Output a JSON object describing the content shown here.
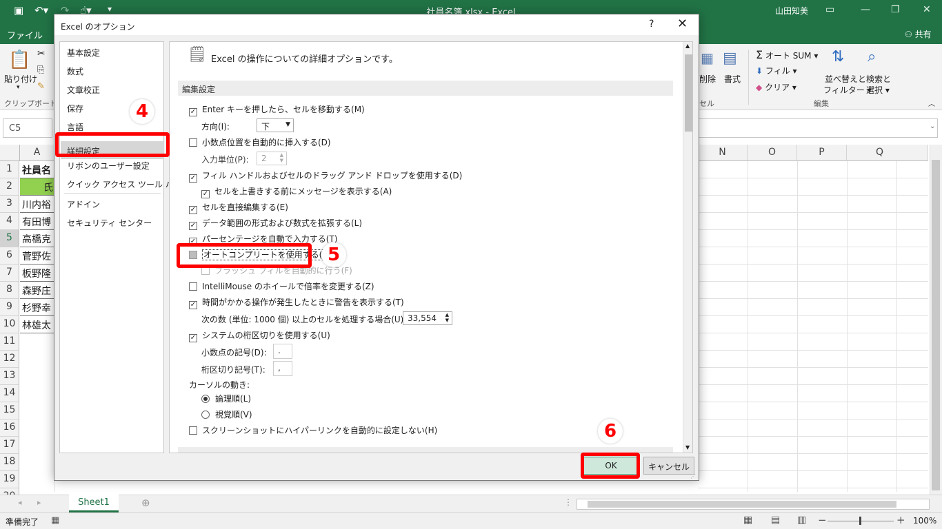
{
  "window": {
    "title": "社員名簿.xlsx  -  Excel",
    "user": "山田知美"
  },
  "ribbon": {
    "file_tab": "ファイル",
    "share": "共有",
    "paste_label": "貼り付け",
    "clipboard_group": "クリップボード",
    "delete_label": "削除",
    "format_label": "書式",
    "cells_group": "セル",
    "autosum": "オート SUM",
    "fill": "フィル",
    "clear": "クリア",
    "sort_filter_1": "並べ替えと",
    "sort_filter_2": "フィルター",
    "find_select_1": "検索と",
    "find_select_2": "選択",
    "edit_group": "編集"
  },
  "formula_bar": {
    "name_box": "C5"
  },
  "grid": {
    "col_headers_right": [
      "N",
      "O",
      "P",
      "Q"
    ],
    "row_numbers": [
      "1",
      "2",
      "3",
      "4",
      "5",
      "6",
      "7",
      "8",
      "9",
      "10",
      "11",
      "12",
      "13",
      "14",
      "15",
      "16",
      "17",
      "18",
      "19",
      "20"
    ],
    "a1": "社員名",
    "a2": "氏",
    "names": [
      "川内裕",
      "有田博",
      "高橋克",
      "菅野佐",
      "板野隆",
      "森野庄",
      "杉野幸",
      "林雄太"
    ]
  },
  "sheet_tabs": {
    "sheet1": "Sheet1"
  },
  "status_bar": {
    "ready": "準備完了",
    "zoom": "100%"
  },
  "dialog": {
    "title": "Excel のオプション",
    "help": "?",
    "close": "✕",
    "nav": [
      "基本設定",
      "数式",
      "文章校正",
      "保存",
      "言語",
      "詳細設定",
      "リボンのユーザー設定",
      "クイック アクセス ツール バー",
      "アドイン",
      "セキュリティ センター"
    ],
    "header": "Excel の操作についての詳細オプションです。",
    "section_edit": "編集設定",
    "options": {
      "enter_move": "Enter キーを押したら、セルを移動する(M)",
      "direction_label": "方向(I):",
      "direction_value": "下",
      "auto_decimal": "小数点位置を自動的に挿入する(D)",
      "places_label": "入力単位(P):",
      "places_value": "2",
      "fill_handle": "フィル ハンドルおよびセルのドラッグ アンド ドロップを使用する(D)",
      "alert_overwrite": "セルを上書きする前にメッセージを表示する(A)",
      "edit_in_cell": "セルを直接編集する(E)",
      "extend_formats": "データ範囲の形式および数式を拡張する(L)",
      "auto_percent": "パーセンテージを自動で入力する(T)",
      "autocomplete": "オートコンプリートを使用する(A)",
      "flash_fill": "フラッシュ フィルを自動的に行う(F)",
      "intellimouse": "IntelliMouse のホイールで倍率を変更する(Z)",
      "alert_slow": "時間がかかる操作が発生したときに警告を表示する(T)",
      "cells_threshold_label": "次の数 (単位: 1000 個) 以上のセルを処理する場合(U):",
      "cells_threshold_value": "33,554",
      "system_separators": "システムの桁区切りを使用する(U)",
      "decimal_sep_label": "小数点の記号(D):",
      "decimal_sep_value": ".",
      "thousands_sep_label": "桁区切り記号(T):",
      "thousands_sep_value": ",",
      "cursor_movement": "カーソルの動き:",
      "logical": "論理順(L)",
      "visual": "視覚順(V)",
      "no_hyperlink_screenshot": "スクリーンショットにハイパーリンクを自動的に設定しない(H)"
    },
    "ok": "OK",
    "cancel": "キャンセル"
  },
  "annotations": {
    "step4": "4",
    "step5": "5",
    "step6": "6"
  },
  "colors": {
    "excel_green": "#217346",
    "highlight_red": "#ff0000",
    "ok_fill": "#cfe8dc",
    "name_fill": "#92d050"
  }
}
